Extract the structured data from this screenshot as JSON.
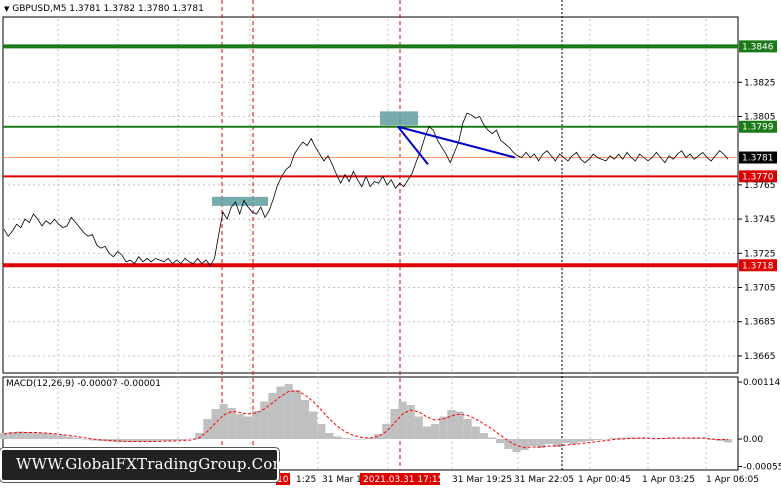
{
  "chart_data": [
    {
      "type": "line",
      "title": "GBPUSD,M5  1.3781 1.3782 1.3780 1.3781",
      "symbol": "GBPUSD",
      "timeframe": "M5",
      "ohlc": {
        "open": 1.3781,
        "high": 1.3782,
        "low": 1.378,
        "close": 1.3781
      },
      "ylim": [
        1.3655,
        1.3862
      ],
      "yticks": [
        "1.3825",
        "1.3805",
        "1.3765",
        "1.3745",
        "1.3725",
        "1.3705",
        "1.3685",
        "1.3665"
      ],
      "xticks": [
        "1:25",
        "31 Mar 1",
        "31 Mar 19:25",
        "31 Mar 22:05",
        "1 Apr 00:45",
        "1 Apr 03:25",
        "1 Apr 06:05"
      ],
      "highlighted_time": "2021.03.31 17:15",
      "partial_tick": "10",
      "levels": [
        {
          "value": 1.3846,
          "label": "1.3846",
          "color": "#1a7a1a"
        },
        {
          "value": 1.3799,
          "label": "1.3799",
          "color": "#1a7a1a"
        },
        {
          "value": 1.377,
          "label": "1.3770",
          "color": "#dd0000"
        },
        {
          "value": 1.3718,
          "label": "1.3718",
          "color": "#dd0000"
        }
      ],
      "current_price": {
        "value": 1.3781,
        "label": "1.3781"
      },
      "grid": true,
      "series": [
        {
          "values": [
            1.3739,
            1.3735,
            1.3738,
            1.3742,
            1.374,
            1.3745,
            1.3743,
            1.3748,
            1.3745,
            1.3741,
            1.3744,
            1.3742,
            1.3745,
            1.3742,
            1.374,
            1.3741,
            1.3746,
            1.3743,
            1.374,
            1.3737,
            1.3735,
            1.3736,
            1.373,
            1.3728,
            1.3729,
            1.3725,
            1.3723,
            1.3726,
            1.3724,
            1.372,
            1.3721,
            1.3719,
            1.3723,
            1.372,
            1.3722,
            1.372,
            1.3722,
            1.3721,
            1.372,
            1.3722,
            1.3719,
            1.3721,
            1.3719,
            1.3722,
            1.372,
            1.3719,
            1.3722,
            1.3719,
            1.3721,
            1.3718,
            1.3722,
            1.3736,
            1.3749,
            1.3745,
            1.3752,
            1.3755,
            1.3748,
            1.3756,
            1.3752,
            1.3749,
            1.3748,
            1.3752,
            1.3746,
            1.375,
            1.3757,
            1.3765,
            1.377,
            1.3774,
            1.3776,
            1.3783,
            1.3787,
            1.379,
            1.3788,
            1.3792,
            1.3787,
            1.3783,
            1.3779,
            1.3782,
            1.3777,
            1.3771,
            1.3766,
            1.3771,
            1.3767,
            1.3773,
            1.3768,
            1.3764,
            1.377,
            1.3764,
            1.3767,
            1.3766,
            1.377,
            1.3765,
            1.3768,
            1.3763,
            1.3766,
            1.3764,
            1.3768,
            1.3772,
            1.3779,
            1.3785,
            1.3793,
            1.3799,
            1.3797,
            1.3791,
            1.3787,
            1.3783,
            1.3778,
            1.3784,
            1.379,
            1.3801,
            1.3807,
            1.3806,
            1.3804,
            1.3805,
            1.38,
            1.3797,
            1.3795,
            1.3797,
            1.3791,
            1.3789,
            1.3787,
            1.3784,
            1.3782,
            1.3781,
            1.3784,
            1.3781,
            1.3783,
            1.3779,
            1.3783,
            1.3785,
            1.3782,
            1.3779,
            1.3783,
            1.3781,
            1.3779,
            1.3782,
            1.3784,
            1.378,
            1.3778,
            1.378,
            1.3783,
            1.3781,
            1.378,
            1.3779,
            1.3782,
            1.378,
            1.3783,
            1.378,
            1.3784,
            1.3781,
            1.3779,
            1.3783,
            1.3781,
            1.3779,
            1.3781,
            1.3784,
            1.3781,
            1.3778,
            1.3782,
            1.378,
            1.3783,
            1.3785,
            1.3781,
            1.3783,
            1.378,
            1.3782,
            1.3784,
            1.3781,
            1.3779,
            1.3782,
            1.3785,
            1.3783,
            1.378
          ]
        },
        {
          "name": "",
          "values": []
        }
      ],
      "trend_lines": [
        {
          "from": [
            1.3799,
            0
          ],
          "to": [
            1.3781,
            1
          ],
          "color": "#0000cc"
        },
        {
          "from": [
            1.3799,
            0
          ],
          "to": [
            1.3777,
            1
          ],
          "color": "#0000cc"
        }
      ]
    },
    {
      "type": "area",
      "title": "MACD(12,26,9) -0.00007 -0.00001",
      "yticks": [
        "0.00114",
        "0.00",
        "-0.00055"
      ],
      "ylim": [
        -0.00062,
        0.00124
      ],
      "series": [
        {
          "values": [
            0.00012,
            0.00014,
            0.00015,
            0.00014,
            0.00013,
            0.00012,
            0.0001,
            8e-05,
            5e-05,
            2e-05,
            -1e-05,
            -3e-05,
            -4e-05,
            -5e-05,
            -6e-05,
            -6e-05,
            -6e-05,
            -5e-05,
            -5e-05,
            -4e-05,
            -4e-05,
            -3e-05,
            -2e-05,
            1e-05,
            0.00012,
            0.0004,
            0.0006,
            0.0007,
            0.00062,
            0.0005,
            0.00045,
            0.00056,
            0.00075,
            0.00092,
            0.00105,
            0.0011,
            0.00098,
            0.00078,
            0.00055,
            0.0003,
            0.00012,
            5e-05,
            2e-05,
            0.0,
            -1e-05,
            2e-05,
            0.0001,
            0.0003,
            0.0006,
            0.00075,
            0.00068,
            0.00045,
            0.00025,
            0.0003,
            0.00045,
            0.00058,
            0.00055,
            0.0004,
            0.00025,
            0.00012,
            3e-05,
            -8e-05,
            -0.0002,
            -0.00026,
            -0.00022,
            -0.00014,
            -0.00018,
            -0.0001,
            -0.00016,
            -8e-05,
            -0.0001,
            -6e-05,
            -4e-05,
            -2e-05,
            0.0,
            2e-05,
            3e-05,
            3e-05,
            2e-05,
            1e-05,
            0.0,
            2e-05,
            3e-05,
            1e-05,
            2e-05,
            3e-05,
            1e-05,
            -2e-05,
            -4e-05,
            -7e-05
          ]
        },
        {
          "values": [
            0.0001,
            0.00012,
            0.00013,
            0.00013,
            0.00013,
            0.00012,
            0.00011,
            9e-05,
            7e-05,
            5e-05,
            2e-05,
            0.0,
            -2e-05,
            -3e-05,
            -4e-05,
            -5e-05,
            -5e-05,
            -5e-05,
            -5e-05,
            -5e-05,
            -4e-05,
            -4e-05,
            -3e-05,
            -2e-05,
            2e-05,
            0.00015,
            0.00032,
            0.00048,
            0.00055,
            0.00053,
            0.0005,
            0.00052,
            0.0006,
            0.00072,
            0.00085,
            0.00095,
            0.00096,
            0.00088,
            0.00075,
            0.00058,
            0.0004,
            0.00025,
            0.00014,
            7e-05,
            3e-05,
            2e-05,
            5e-05,
            0.00015,
            0.00032,
            0.0005,
            0.00058,
            0.00054,
            0.00044,
            0.00038,
            0.0004,
            0.00046,
            0.0005,
            0.00047,
            0.0004,
            0.0003,
            0.0002,
            8e-05,
            -4e-05,
            -0.00013,
            -0.00017,
            -0.00016,
            -0.00016,
            -0.00014,
            -0.00014,
            -0.00012,
            -0.00011,
            -9e-05,
            -7e-05,
            -5e-05,
            -3e-05,
            -1e-05,
            0.0,
            1e-05,
            2e-05,
            2e-05,
            1e-05,
            1e-05,
            2e-05,
            2e-05,
            2e-05,
            2e-05,
            2e-05,
            0.0,
            -1e-05,
            -1e-05
          ]
        }
      ]
    }
  ],
  "watermark": "WWW.GlobalFXTradingGroup.Com",
  "colors": {
    "price_line": "#000000",
    "green_level": "#1a7a1a",
    "red_level": "#dd0000",
    "trend": "#0000cc",
    "teal_box": "#5f9ea0",
    "macd_hist": "#c0c0c0",
    "signal": "#ff0000",
    "grid": "#c0c0c0"
  }
}
